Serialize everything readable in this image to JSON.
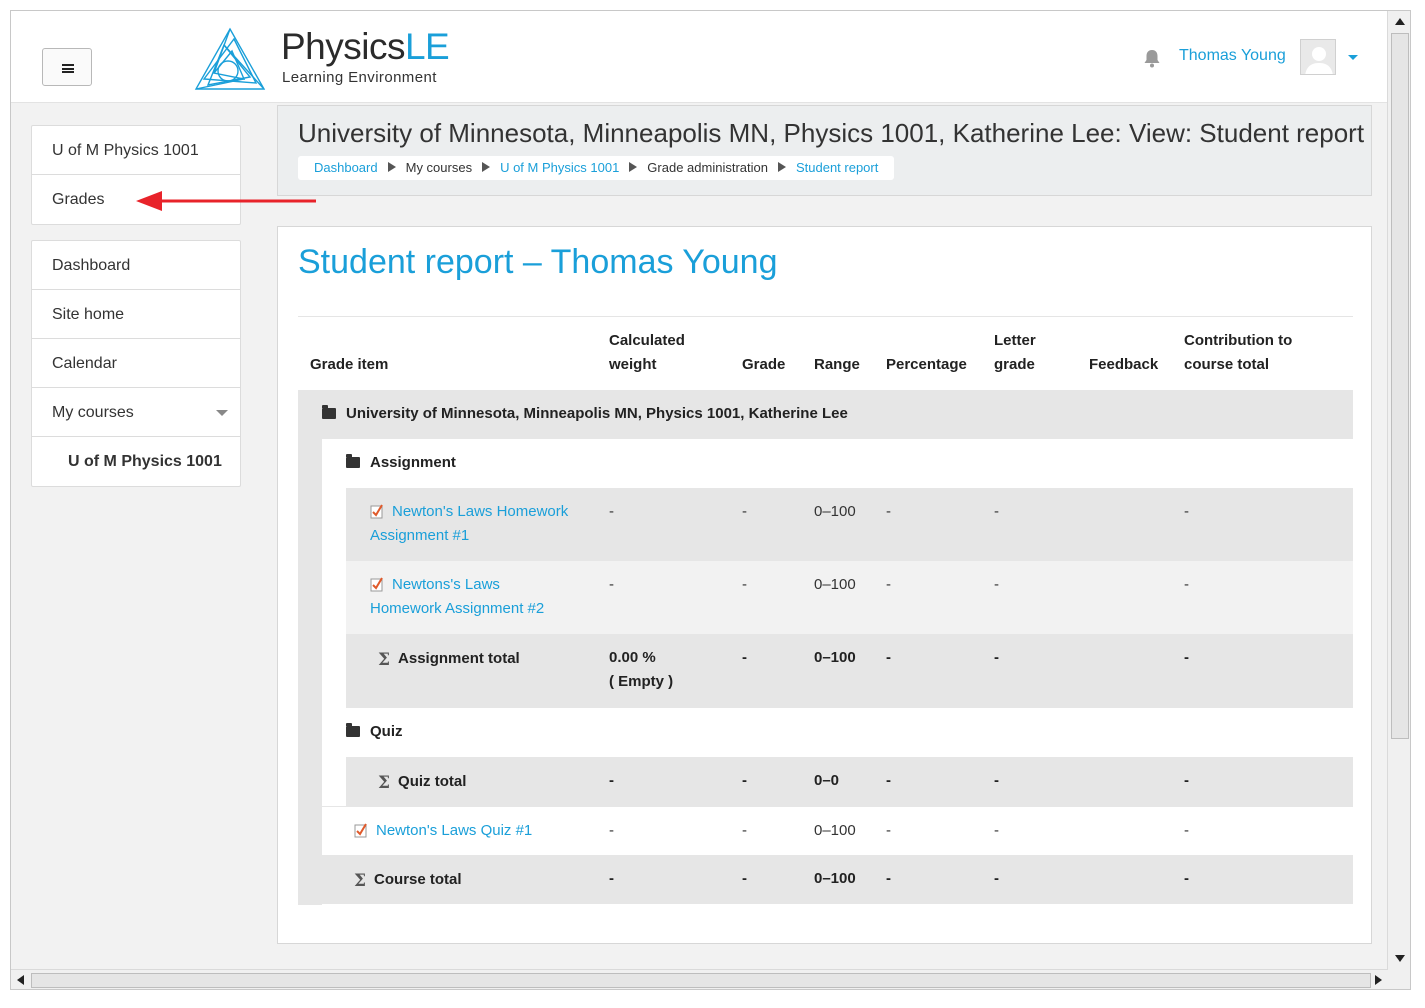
{
  "navbar": {
    "brand_main": "Physics",
    "brand_accent": "LE",
    "brand_sub": "Learning Environment",
    "user_name": "Thomas Young"
  },
  "drawer": {
    "course_block": [
      "U of M Physics 1001",
      "Grades"
    ],
    "nav_block": [
      {
        "label": "Dashboard"
      },
      {
        "label": "Site home"
      },
      {
        "label": "Calendar"
      },
      {
        "label": "My courses"
      },
      {
        "label": "U of M Physics 1001"
      }
    ]
  },
  "header": {
    "title": "University of Minnesota, Minneapolis MN, Physics 1001, Katherine Lee: View: Student report",
    "breadcrumb": [
      "Dashboard",
      "My courses",
      "U of M Physics 1001",
      "Grade administration",
      "Student report"
    ]
  },
  "report": {
    "title": "Student report – Thomas Young",
    "columns": {
      "item": "Grade item",
      "weight_1": "Calculated",
      "weight_2": "weight",
      "grade": "Grade",
      "range": "Range",
      "percentage": "Percentage",
      "letter_1": "Letter",
      "letter_2": "grade",
      "feedback": "Feedback",
      "contrib_1": "Contribution to",
      "contrib_2": "course total"
    },
    "course_category": "University of Minnesota, Minneapolis MN, Physics 1001, Katherine Lee",
    "assignment_category": "Assignment",
    "items": [
      {
        "name_1": "Newton's Laws Homework",
        "name_2": "Assignment #1",
        "weight": "-",
        "grade": "-",
        "range": "0–100",
        "percentage": "-",
        "letter": "-",
        "contribution": "-"
      },
      {
        "name_1": "Newtons's Laws",
        "name_2": "Homework Assignment #2",
        "weight": "-",
        "grade": "-",
        "range": "0–100",
        "percentage": "-",
        "letter": "-",
        "contribution": "-"
      }
    ],
    "assignment_total": {
      "label": "Assignment total",
      "weight_1": "0.00 %",
      "weight_2": "( Empty )",
      "grade": "-",
      "range": "0–100",
      "percentage": "-",
      "letter": "-",
      "contribution": "-"
    },
    "quiz_category": "Quiz",
    "quiz_total": {
      "label": "Quiz total",
      "weight": "-",
      "grade": "-",
      "range": "0–0",
      "percentage": "-",
      "letter": "-",
      "contribution": "-"
    },
    "quiz_item": {
      "name": "Newton's Laws Quiz #1",
      "weight": "-",
      "grade": "-",
      "range": "0–100",
      "percentage": "-",
      "letter": "-",
      "contribution": "-"
    },
    "course_total": {
      "label": "Course total",
      "weight": "-",
      "grade": "-",
      "range": "0–100",
      "percentage": "-",
      "letter": "-",
      "contribution": "-"
    }
  },
  "colors": {
    "accent": "#1a9fd9",
    "arrow": "#e8232a"
  }
}
